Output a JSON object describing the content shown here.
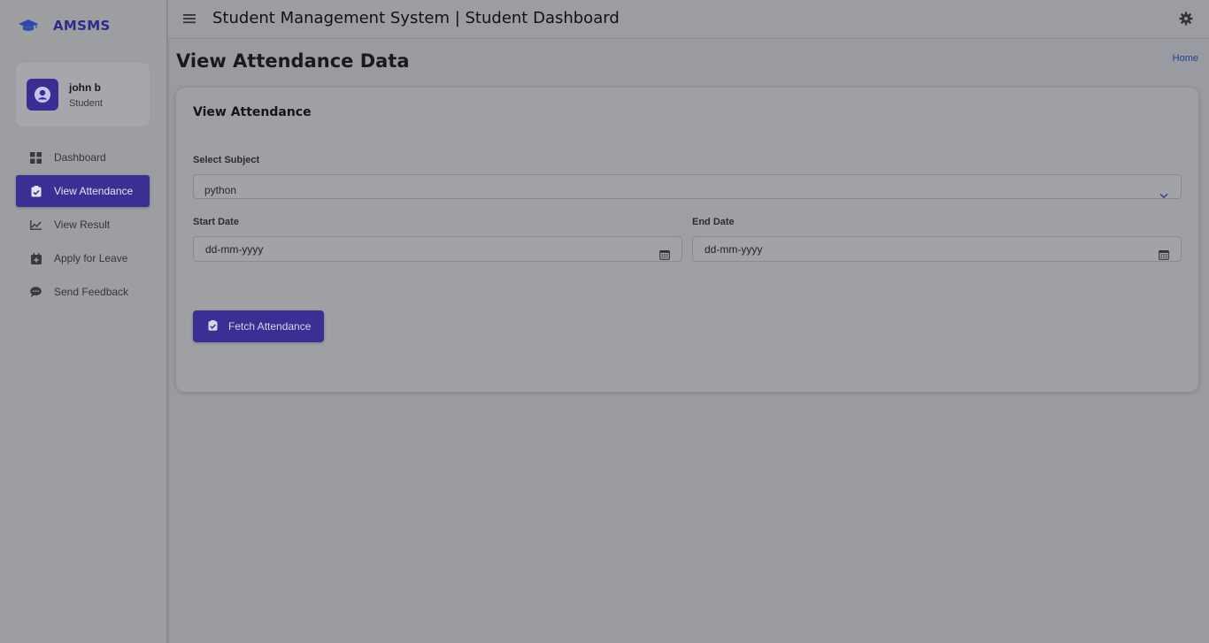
{
  "brand": {
    "name": "AMSMS",
    "icon": "graduation-cap-icon",
    "color": "#2e2a8a"
  },
  "user": {
    "name": "john b",
    "role": "Student",
    "avatar_icon": "user-circle-icon"
  },
  "sidebar": {
    "items": [
      {
        "label": "Dashboard",
        "icon": "dashboard-grid-icon",
        "active": false
      },
      {
        "label": "View Attendance",
        "icon": "clipboard-check-icon",
        "active": true
      },
      {
        "label": "View Result",
        "icon": "line-chart-icon",
        "active": false
      },
      {
        "label": "Apply for Leave",
        "icon": "calendar-plus-icon",
        "active": false
      },
      {
        "label": "Send Feedback",
        "icon": "chat-bubble-icon",
        "active": false
      }
    ]
  },
  "header": {
    "title": "Student Management System | Student Dashboard",
    "menu_icon": "hamburger-icon",
    "settings_icon": "gear-icon"
  },
  "page": {
    "title": "View Attendance Data",
    "breadcrumb": "Home"
  },
  "card": {
    "title": "View Attendance",
    "subject_label": "Select Subject",
    "subject_value": "python",
    "start_label": "Start Date",
    "start_placeholder": "dd-mm-yyyy",
    "end_label": "End Date",
    "end_placeholder": "dd-mm-yyyy",
    "button_label": "Fetch Attendance"
  },
  "colors": {
    "accent": "#3a2f92",
    "link": "#1a3f8e",
    "background": "#9a9ba0"
  }
}
